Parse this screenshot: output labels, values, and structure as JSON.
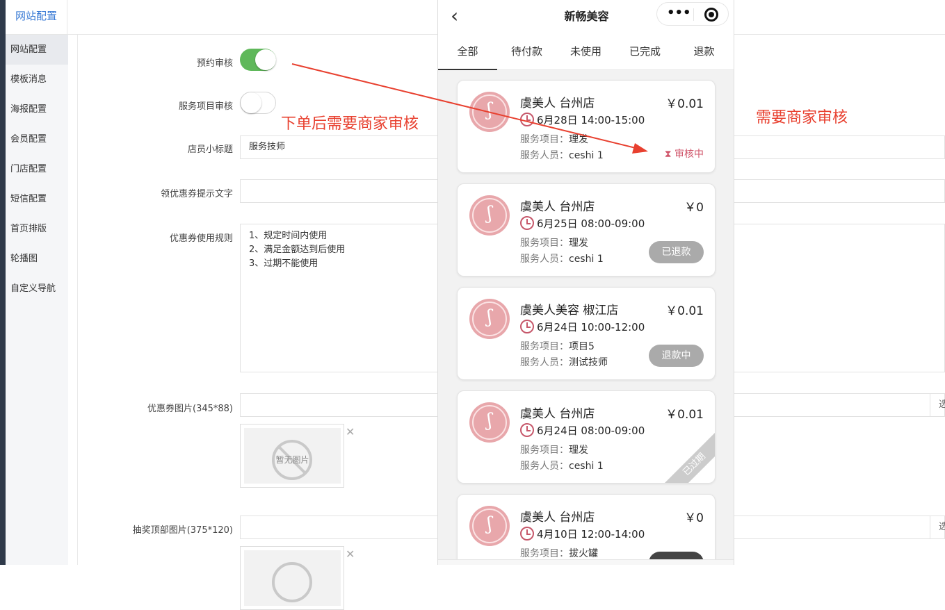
{
  "header": {
    "title": "网站配置"
  },
  "sidebar": {
    "items": [
      "网站配置",
      "模板消息",
      "海报配置",
      "会员配置",
      "门店配置",
      "短信配置",
      "首页排版",
      "轮播图",
      "自定义导航"
    ]
  },
  "form": {
    "booking_review_label": "预约审核",
    "service_review_label": "服务项目审核",
    "staff_subtitle_label": "店员小标题",
    "staff_subtitle_value": "服务技师",
    "coupon_tip_label": "领优惠券提示文字",
    "coupon_tip_value": "",
    "coupon_rules_label": "优惠券使用规则",
    "coupon_rules_lines": [
      "1、规定时间内使用",
      "2、满足金额达到后使用",
      "3、过期不能使用"
    ],
    "coupon_image_label": "优惠券图片(345*88)",
    "lottery_image_label": "抽奖顶部图片(375*120)",
    "no_image_text": "暂无图片",
    "select_button": "选",
    "remove_icon": "✕"
  },
  "phone": {
    "title": "新畅美容",
    "back_icon": "‹",
    "tabs": [
      "全部",
      "待付款",
      "未使用",
      "已完成",
      "退款"
    ],
    "cards": [
      {
        "shop": "虞美人 台州店",
        "price": "￥0.01",
        "time": "6月28日 14:00-15:00",
        "service_label": "服务项目：",
        "service": "理发",
        "staff_label": "服务人员：",
        "staff": "ceshi 1",
        "status": "审核中"
      },
      {
        "shop": "虞美人 台州店",
        "price": "￥0",
        "time": "6月25日 08:00-09:00",
        "service_label": "服务项目：",
        "service": "理发",
        "staff_label": "服务人员：",
        "staff": "ceshi 1",
        "status": "已退款"
      },
      {
        "shop": "虞美人美容 椒江店",
        "price": "￥0.01",
        "time": "6月24日 10:00-12:00",
        "service_label": "服务项目：",
        "service": "项目5",
        "staff_label": "服务人员：",
        "staff": "测试技师",
        "status": "退款中"
      },
      {
        "shop": "虞美人 台州店",
        "price": "￥0.01",
        "time": "6月24日 08:00-09:00",
        "service_label": "服务项目：",
        "service": "理发",
        "staff_label": "服务人员：",
        "staff": "ceshi 1",
        "status": "已过期"
      },
      {
        "shop": "虞美人 台州店",
        "price": "￥0",
        "time": "4月10日 12:00-14:00",
        "service_label": "服务项目：",
        "service": "拔火罐",
        "staff_label": "",
        "staff": "",
        "status": ""
      }
    ]
  },
  "annotations": {
    "left": "下单后需要商家审核",
    "right": "需要商家审核"
  },
  "colors": {
    "accent_green": "#5fb85a",
    "annotation_red": "#e8402f",
    "audit_pink": "#d0566b"
  }
}
